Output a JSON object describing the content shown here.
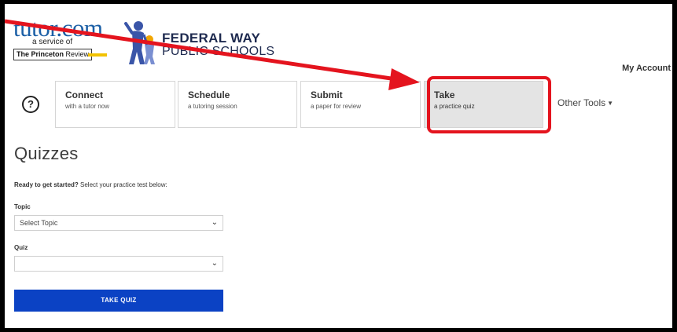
{
  "header": {
    "tutor_wordmark": "tutor.com",
    "tutor_sub": "a service of",
    "pr_bold": "The Princeton",
    "pr_rest": " Review",
    "district_line1": "FEDERAL WAY",
    "district_line2": "PUBLIC SCHOOLS",
    "account_label": "My Account"
  },
  "nav": {
    "help_symbol": "?",
    "cards": [
      {
        "title": "Connect",
        "subtitle": "with a tutor now"
      },
      {
        "title": "Schedule",
        "subtitle": "a tutoring session"
      },
      {
        "title": "Submit",
        "subtitle": "a paper for review"
      },
      {
        "title": "Take",
        "subtitle": "a practice quiz"
      }
    ],
    "other_tools": "Other Tools"
  },
  "main": {
    "title": "Quizzes",
    "intro_bold": "Ready to get started?",
    "intro_rest": " Select your practice test below:",
    "topic_label": "Topic",
    "topic_value": "Select Topic",
    "quiz_label": "Quiz",
    "quiz_value": "",
    "button_label": "TAKE QUIZ"
  },
  "colors": {
    "accent_button": "#0b42c4",
    "annotation_red": "#e4141e",
    "tutor_blue": "#1b5fa6"
  }
}
